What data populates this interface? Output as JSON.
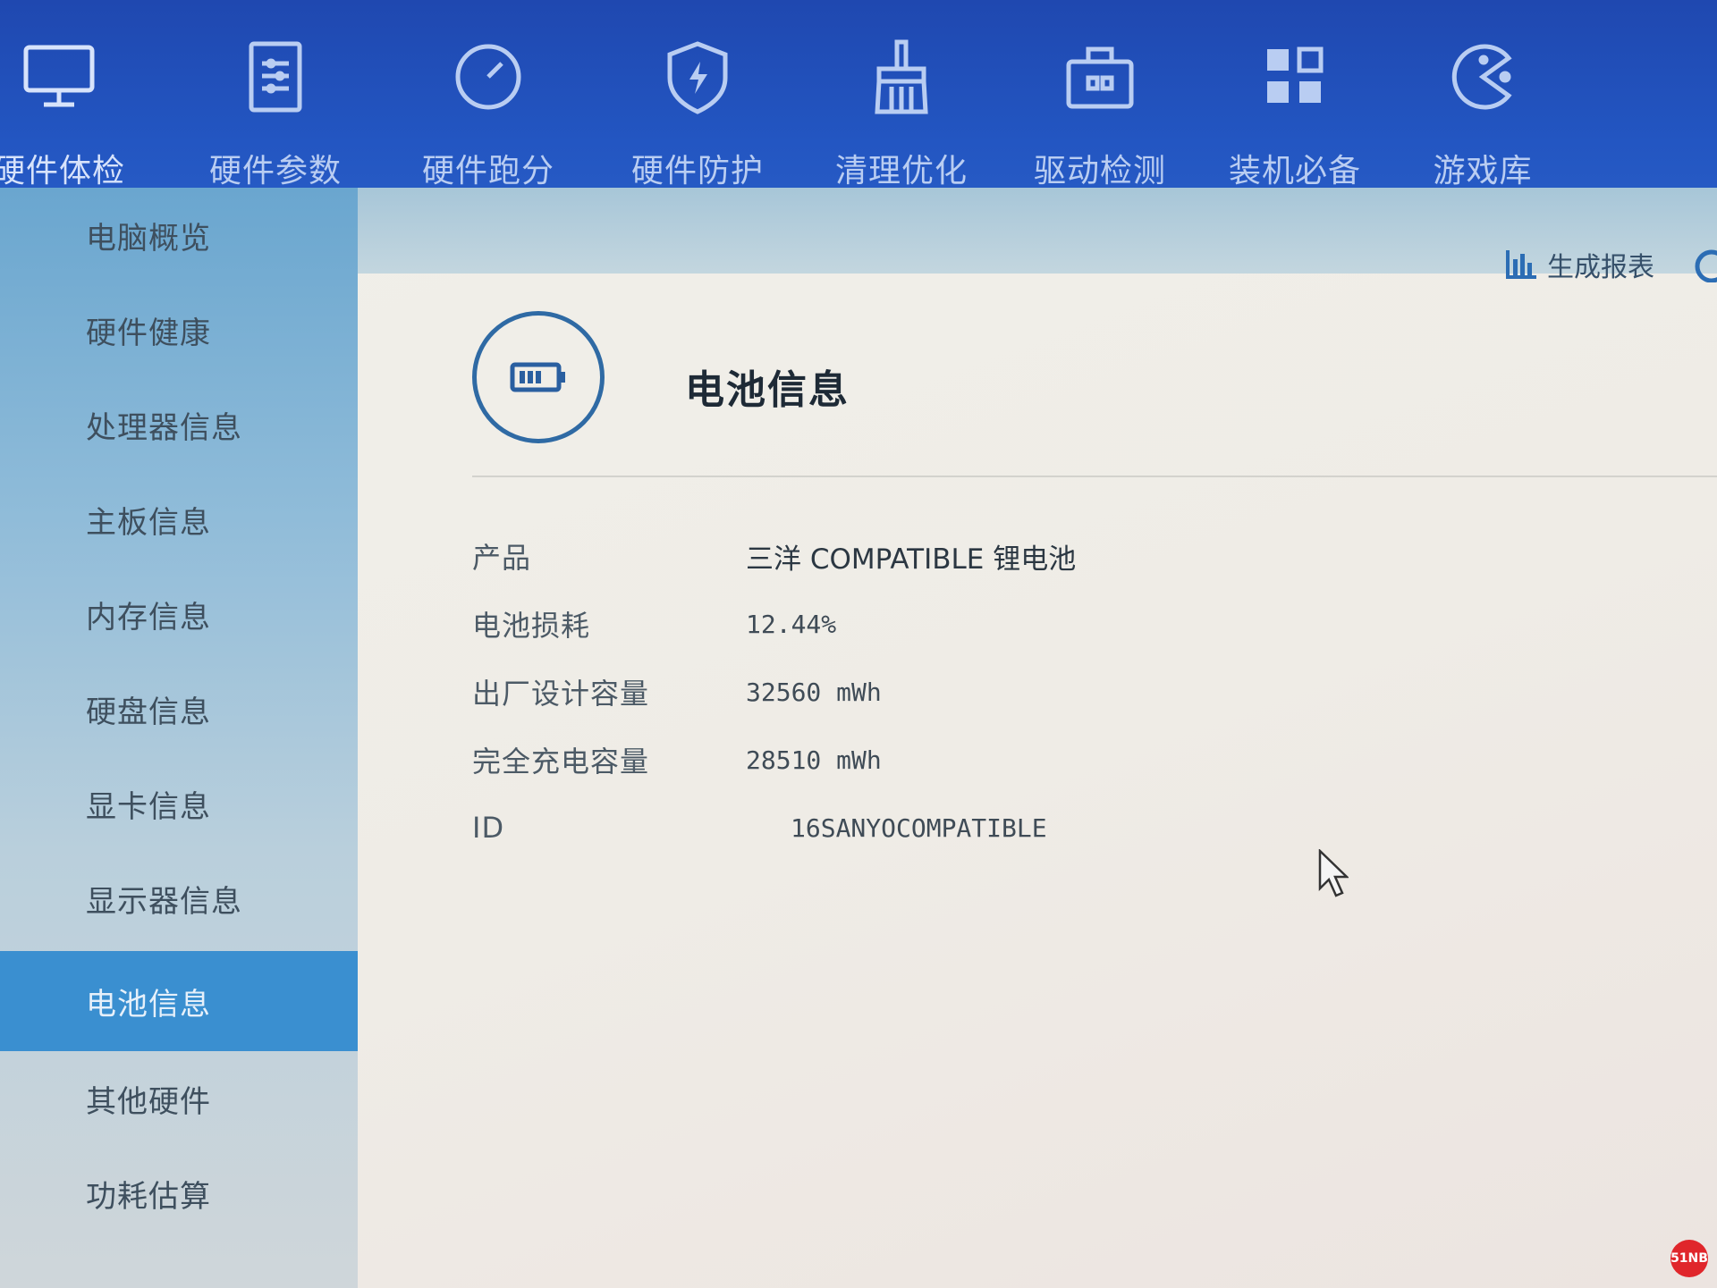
{
  "nav": {
    "items": [
      {
        "label": "硬件体检",
        "icon": "monitor-icon"
      },
      {
        "label": "硬件参数",
        "icon": "clipboard-icon"
      },
      {
        "label": "硬件跑分",
        "icon": "gauge-icon"
      },
      {
        "label": "硬件防护",
        "icon": "shield-icon"
      },
      {
        "label": "清理优化",
        "icon": "broom-icon"
      },
      {
        "label": "驱动检测",
        "icon": "toolbox-icon"
      },
      {
        "label": "装机必备",
        "icon": "apps-grid-icon"
      },
      {
        "label": "游戏库",
        "icon": "gamepad-icon"
      }
    ]
  },
  "sidebar": {
    "items": [
      {
        "label": "电脑概览"
      },
      {
        "label": "硬件健康"
      },
      {
        "label": "处理器信息"
      },
      {
        "label": "主板信息"
      },
      {
        "label": "内存信息"
      },
      {
        "label": "硬盘信息"
      },
      {
        "label": "显卡信息"
      },
      {
        "label": "显示器信息"
      },
      {
        "label": "电池信息"
      },
      {
        "label": "其他硬件"
      },
      {
        "label": "功耗估算"
      }
    ],
    "active": "电池信息"
  },
  "toolbar": {
    "report_label": "生成报表"
  },
  "section": {
    "title": "电池信息"
  },
  "battery": {
    "rows": [
      {
        "key": "产品",
        "value": "三洋 COMPATIBLE 锂电池"
      },
      {
        "key": "电池损耗",
        "value": "12.44%"
      },
      {
        "key": "出厂设计容量",
        "value": "32560 mWh"
      },
      {
        "key": "完全充电容量",
        "value": "28510 mWh"
      },
      {
        "key": "ID",
        "value": "16SANYOCOMPATIBLE"
      }
    ]
  },
  "watermark": {
    "text": "51NB"
  },
  "colors": {
    "nav_bg": "#2356c2",
    "sidebar_active": "#3a8fd0",
    "badge_border": "#2f6aa4"
  }
}
